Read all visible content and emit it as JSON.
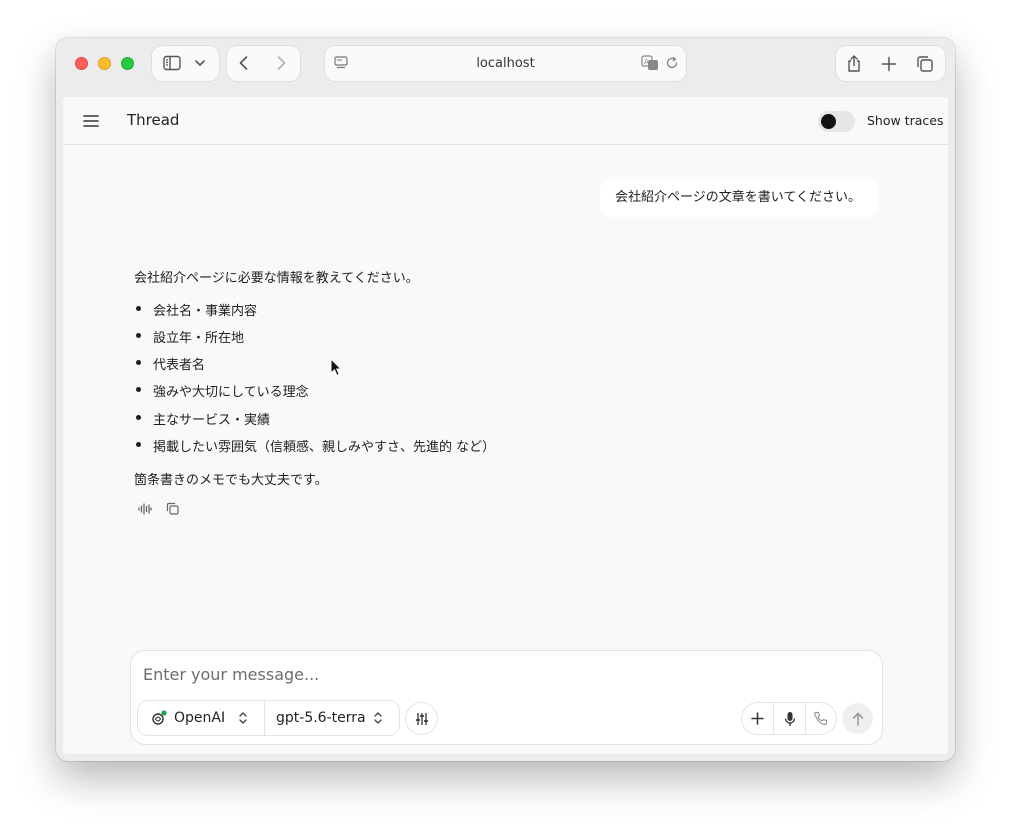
{
  "browser": {
    "url": "localhost"
  },
  "header": {
    "title": "Thread",
    "show_traces_label": "Show traces",
    "show_traces_enabled": false
  },
  "conversation": {
    "user_message": "会社紹介ページの文章を書いてください。",
    "assistant": {
      "intro": "会社紹介ページに必要な情報を教えてください。",
      "items": [
        "会社名・事業内容",
        "設立年・所在地",
        "代表者名",
        "強みや大切にしている理念",
        "主なサービス・実績",
        "掲載したい雰囲気（信頼感、親しみやすさ、先進的 など）"
      ],
      "outro": "箇条書きのメモでも大丈夫です。"
    }
  },
  "composer": {
    "placeholder": "Enter your message...",
    "provider": "OpenAI",
    "model": "gpt-5.6-terra"
  },
  "colors": {
    "provider_status": "#1ea34a",
    "toggle_knob": "#121212"
  }
}
